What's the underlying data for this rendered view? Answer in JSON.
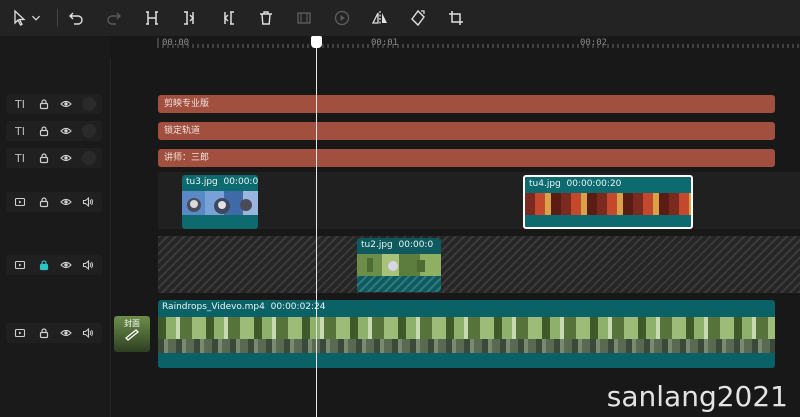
{
  "toolbar": {
    "icons": [
      "pointer-icon",
      "chevron-down-icon",
      "undo-icon",
      "redo-icon",
      "split-icon",
      "split-left-icon",
      "split-right-icon",
      "delete-icon",
      "freeze-icon",
      "play-circle-icon",
      "mirror-icon",
      "rotate-icon",
      "crop-icon"
    ]
  },
  "ruler": {
    "labels": [
      "00:00",
      "00:01",
      "00:02"
    ]
  },
  "text_tracks": [
    {
      "label": "剪映专业版"
    },
    {
      "label": "锁定轨道"
    },
    {
      "label": "讲师：三郎"
    }
  ],
  "track_heads": {
    "text_icon_label": "TI"
  },
  "clips": {
    "tu3": {
      "name": "tu3.jpg",
      "duration": "00:00:0"
    },
    "tu4": {
      "name": "tu4.jpg",
      "duration": "00:00:00:20"
    },
    "tu2": {
      "name": "tu2.jpg",
      "duration": "00:00:0"
    },
    "main": {
      "name": "Raindrops_Videvo.mp4",
      "duration": "00:00:02:24"
    }
  },
  "cover": {
    "label": "封面"
  },
  "watermark": "sanlang2021",
  "colors": {
    "text_clip": "#a14f3e",
    "media_clip": "#0d6a6e",
    "selected_border": "#ffffff",
    "locked_accent": "#2ec4c4"
  }
}
